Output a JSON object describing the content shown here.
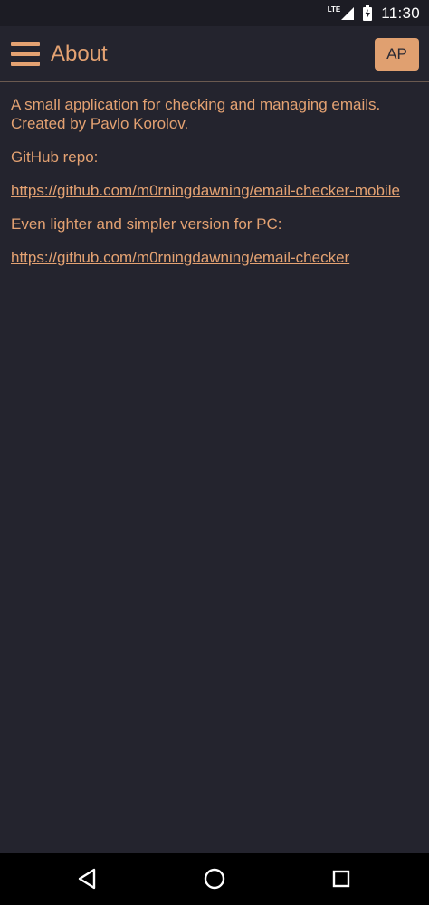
{
  "status_bar": {
    "network": "LTE",
    "time": "11:30",
    "icons": [
      "lte-signal-icon",
      "battery-charging-icon"
    ]
  },
  "app_bar": {
    "menu_icon": "hamburger-menu-icon",
    "title": "About",
    "avatar_label": "AP"
  },
  "about": {
    "description": "A small application for checking and managing emails. Created by Pavlo Korolov.",
    "github_label": "GitHub repo:",
    "github_link": "https://github.com/m0rningdawning/email-checker-mobile",
    "pc_label": "Even lighter and simpler version for PC:",
    "pc_link": "https://github.com/m0rningdawning/email-checker"
  },
  "nav_bar": {
    "icons": [
      "back-icon",
      "home-icon",
      "recent-apps-icon"
    ]
  },
  "colors": {
    "background": "#24242e",
    "accent": "#e4a272",
    "status_bar": "#1c1c24",
    "nav_bar": "#000000"
  }
}
